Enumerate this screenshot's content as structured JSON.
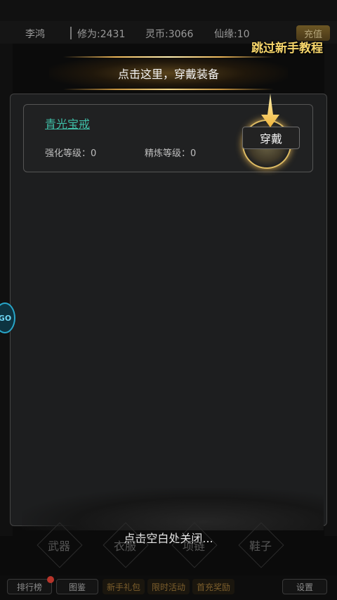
{
  "stats": {
    "name": "李鸿",
    "cultivation": "修为:2431",
    "spirit_coins": "灵币:3066",
    "immortal_fate": "仙缘:10",
    "recharge": "充值"
  },
  "tutorial": {
    "skip": "跳过新手教程",
    "banner": "点击这里，穿戴装备"
  },
  "item": {
    "name": "青光宝戒",
    "enhance_level": "强化等级：0",
    "refine_level": "精炼等级：0",
    "wear_label": "穿戴"
  },
  "close_hint": "点击空白处关闭...",
  "slots": [
    "武器",
    "衣服",
    "项链",
    "鞋子"
  ],
  "bottom_bar": {
    "ranking": "排行榜",
    "atlas": "图鉴",
    "event1": "新手礼包",
    "event2": "限时活动",
    "event3": "首充奖励",
    "settings": "设置"
  },
  "side_logo": "GO",
  "colors": {
    "accent_gold": "#f7d66b",
    "item_cyan": "#3fbfa8",
    "panel_bg": "#1d1e1f"
  }
}
